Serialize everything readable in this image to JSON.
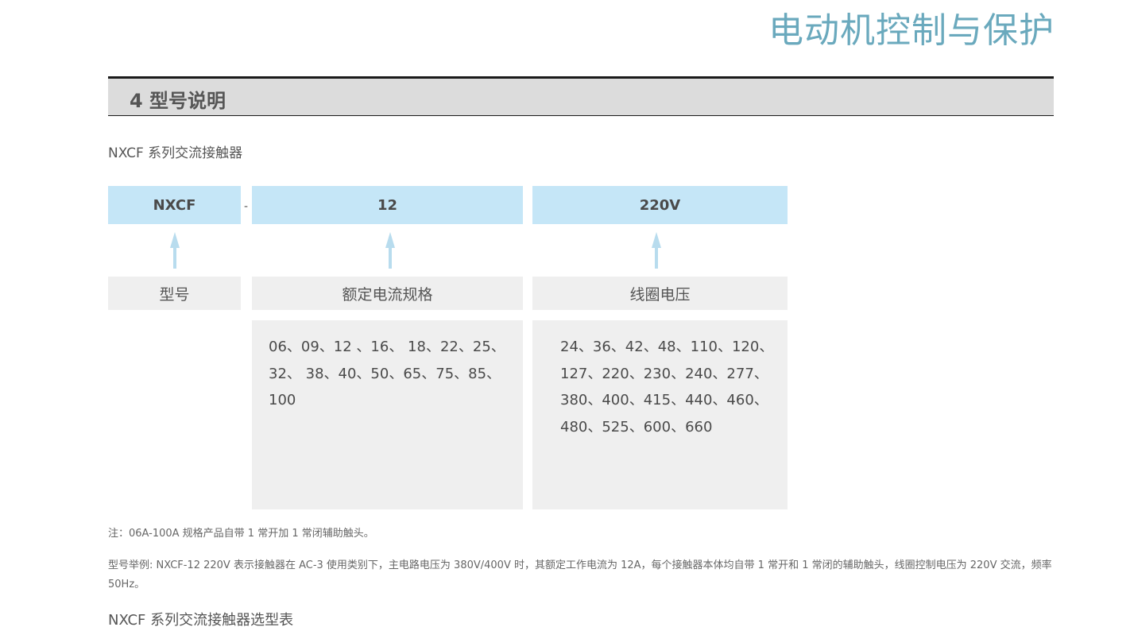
{
  "header": {
    "title": "电动机控制与保护"
  },
  "section": {
    "title": "4 型号说明"
  },
  "subtitle": "NXCF 系列交流接触器",
  "model_code": {
    "parts": [
      "NXCF",
      "12",
      "220V"
    ],
    "separator": "-",
    "labels": [
      "型号",
      "额定电流规格",
      "线圈电压"
    ],
    "current_values": "06、09、12 、16、 18、22、25、32、 38、40、50、65、75、85、100",
    "voltage_values": "24、36、42、48、110、120、127、220、230、240、277、380、400、415、440、460、480、525、600、660"
  },
  "notes": {
    "note1": "注：06A-100A 规格产品自带 1 常开加 1 常闭辅助触头。",
    "note2": "型号举例: NXCF-12 220V 表示接触器在 AC-3 使用类别下，主电路电压为 380V/400V 时，其额定工作电流为 12A，每个接触器本体均自带 1 常开和 1 常闭的辅助触头，线圈控制电压为 220V 交流，频率 50Hz。"
  },
  "footer": {
    "title": "NXCF 系列交流接触器选型表"
  },
  "colors": {
    "accent": "#6aa9bd",
    "code_bg": "#c5e6f7",
    "arrow": "#b8dcee",
    "panel_bg": "#efefef"
  }
}
